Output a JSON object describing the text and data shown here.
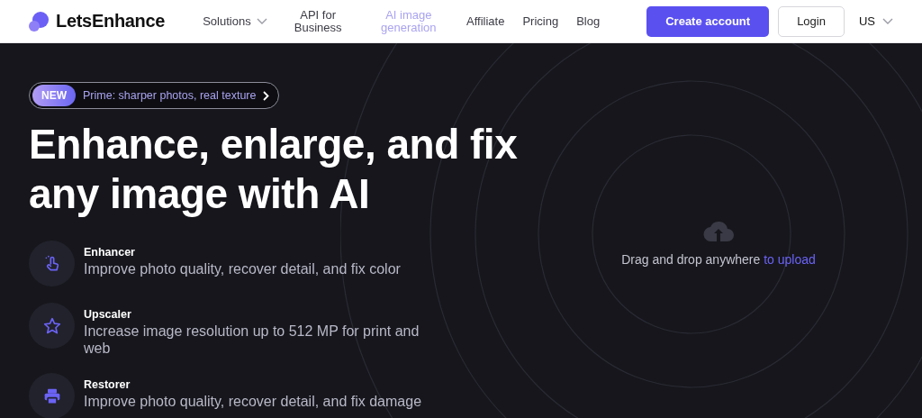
{
  "header": {
    "logo": "LetsEnhance",
    "nav": [
      {
        "label": "Solutions",
        "kind": "dropdown",
        "selected": false
      },
      {
        "label": "API for Business",
        "kind": "link",
        "selected": false
      },
      {
        "label": "AI image generation",
        "kind": "link",
        "selected": true
      },
      {
        "label": "Affiliate",
        "kind": "link",
        "selected": false
      },
      {
        "label": "Pricing",
        "kind": "link",
        "selected": false
      },
      {
        "label": "Blog",
        "kind": "link",
        "selected": false
      }
    ],
    "create_account": "Create account",
    "login": "Login",
    "region": "US"
  },
  "hero": {
    "badge": {
      "tag": "NEW",
      "text": "Prime: sharper photos, real texture"
    },
    "title_lines": [
      "Enhance, enlarge, and fix",
      "any image with AI"
    ],
    "features": [
      {
        "kind": "enhancer",
        "title": "Enhancer",
        "description": "Improve photo quality, recover detail, and fix color"
      },
      {
        "kind": "upscaler",
        "title": "Upscaler",
        "description": "Increase image resolution up to 512 MP for print and web"
      },
      {
        "kind": "restorer",
        "title": "Restorer",
        "description": "Improve photo quality, recover detail, and fix damage"
      }
    ]
  },
  "upload": {
    "text": "Drag and drop anywhere",
    "link": "to upload"
  }
}
